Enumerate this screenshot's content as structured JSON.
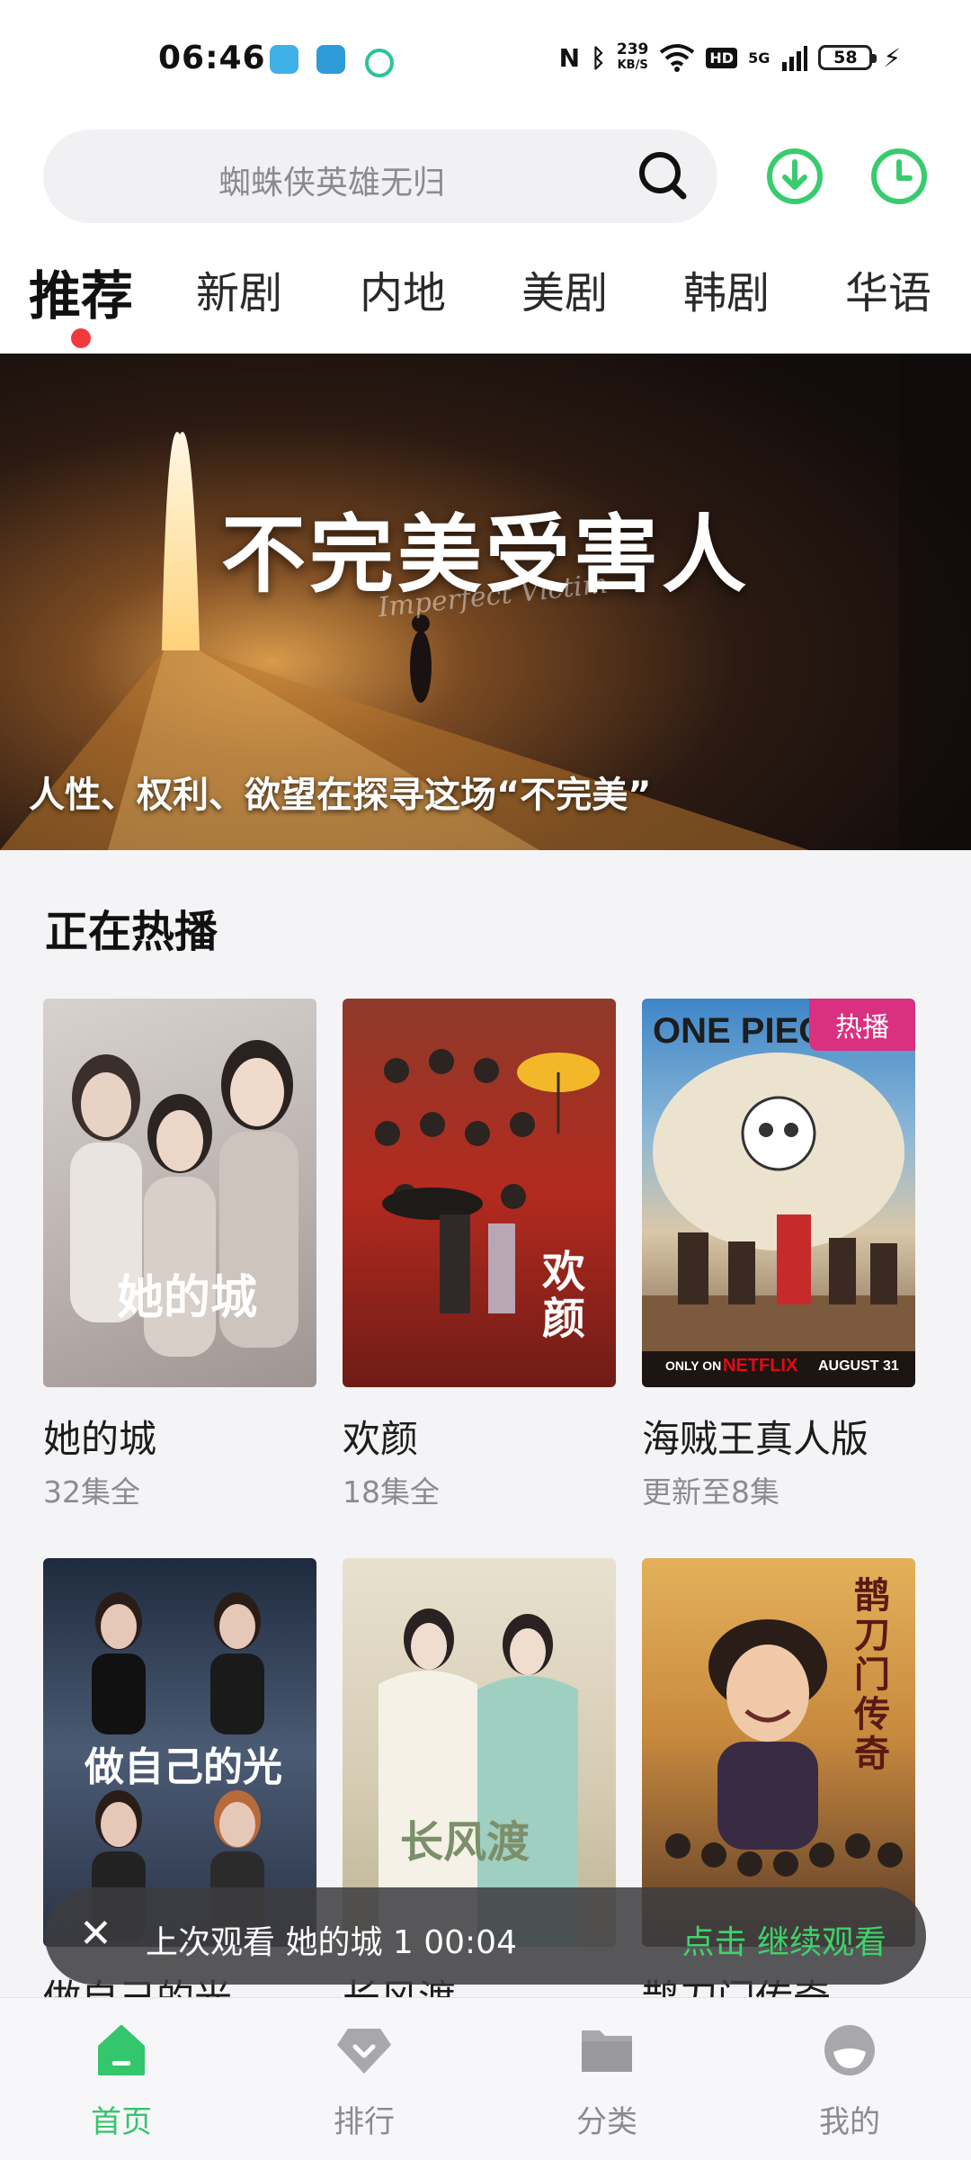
{
  "status_bar": {
    "time": "06:46",
    "network_speed": "239",
    "network_unit": "KB/S",
    "signal": "5G",
    "battery": "58"
  },
  "search": {
    "placeholder": "蜘蛛侠英雄无归"
  },
  "tabs": [
    {
      "label": "推荐",
      "active": true
    },
    {
      "label": "新剧"
    },
    {
      "label": "内地"
    },
    {
      "label": "美剧"
    },
    {
      "label": "韩剧"
    },
    {
      "label": "华语"
    }
  ],
  "banner": {
    "title": "不完美受害人",
    "script": "Imperfect Victim",
    "caption": "人性、权利、欲望在探寻这场“不完美”"
  },
  "section": {
    "title": "正在热播",
    "items": [
      {
        "title": "她的城",
        "subtitle": "32集全",
        "poster_text": "她的城"
      },
      {
        "title": "欢颜",
        "subtitle": "18集全",
        "poster_text": "欢颜"
      },
      {
        "title": "海贼王真人版",
        "subtitle": "更新至8集",
        "badge": "热播",
        "poster_text": "ONE PIECE",
        "poster_footer_left": "ONLY ON",
        "poster_footer_brand": "NETFLIX",
        "poster_footer_date": "AUGUST 31"
      },
      {
        "title": "做自己的光",
        "poster_text": "做自己的光"
      },
      {
        "title": "长风渡",
        "poster_text": "长风渡"
      },
      {
        "title": "鹊刀门传奇",
        "poster_text": "鹊刀门传奇"
      }
    ]
  },
  "continue_bar": {
    "close": "✕",
    "text": "上次观看 她的城 1  00:04",
    "action": "点击 继续观看"
  },
  "bottom_nav": [
    {
      "label": "首页",
      "icon": "home-icon",
      "active": true
    },
    {
      "label": "排行",
      "icon": "ranking-icon"
    },
    {
      "label": "分类",
      "icon": "folder-icon"
    },
    {
      "label": "我的",
      "icon": "profile-icon"
    }
  ],
  "colors": {
    "accent": "#34c66c",
    "tab_dot": "#f2393b",
    "badge": "#d9307f"
  }
}
